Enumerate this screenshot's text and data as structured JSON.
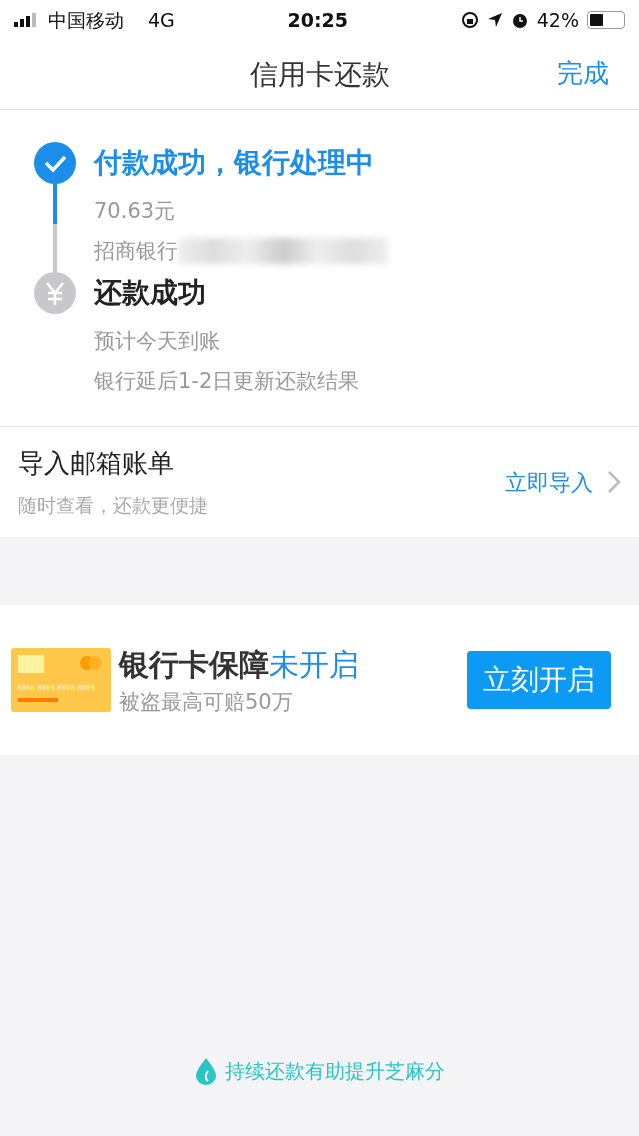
{
  "status_bar": {
    "carrier": "中国移动",
    "network": "4G",
    "time": "20:25",
    "battery_text": "42%"
  },
  "nav": {
    "title": "信用卡还款",
    "action": "完成"
  },
  "steps": [
    {
      "kind": "done",
      "title": "付款成功，银行处理中",
      "lines": [
        "70.63元",
        "招商银行"
      ],
      "redacted": true
    },
    {
      "kind": "pending",
      "title": "还款成功",
      "lines": [
        "预计今天到账",
        "银行延后1-2日更新还款结果"
      ],
      "redacted": false
    }
  ],
  "import_row": {
    "title": "导入邮箱账单",
    "subtitle": "随时查看，还款更便捷",
    "action": "立即导入"
  },
  "guard": {
    "card_number": "8888 8888 8888 8888",
    "title": "银行卡保障",
    "status": "未开启",
    "subtitle": "被盗最高可赔50万",
    "button": "立刻开启"
  },
  "footer": "持续还款有助提升芝麻分"
}
